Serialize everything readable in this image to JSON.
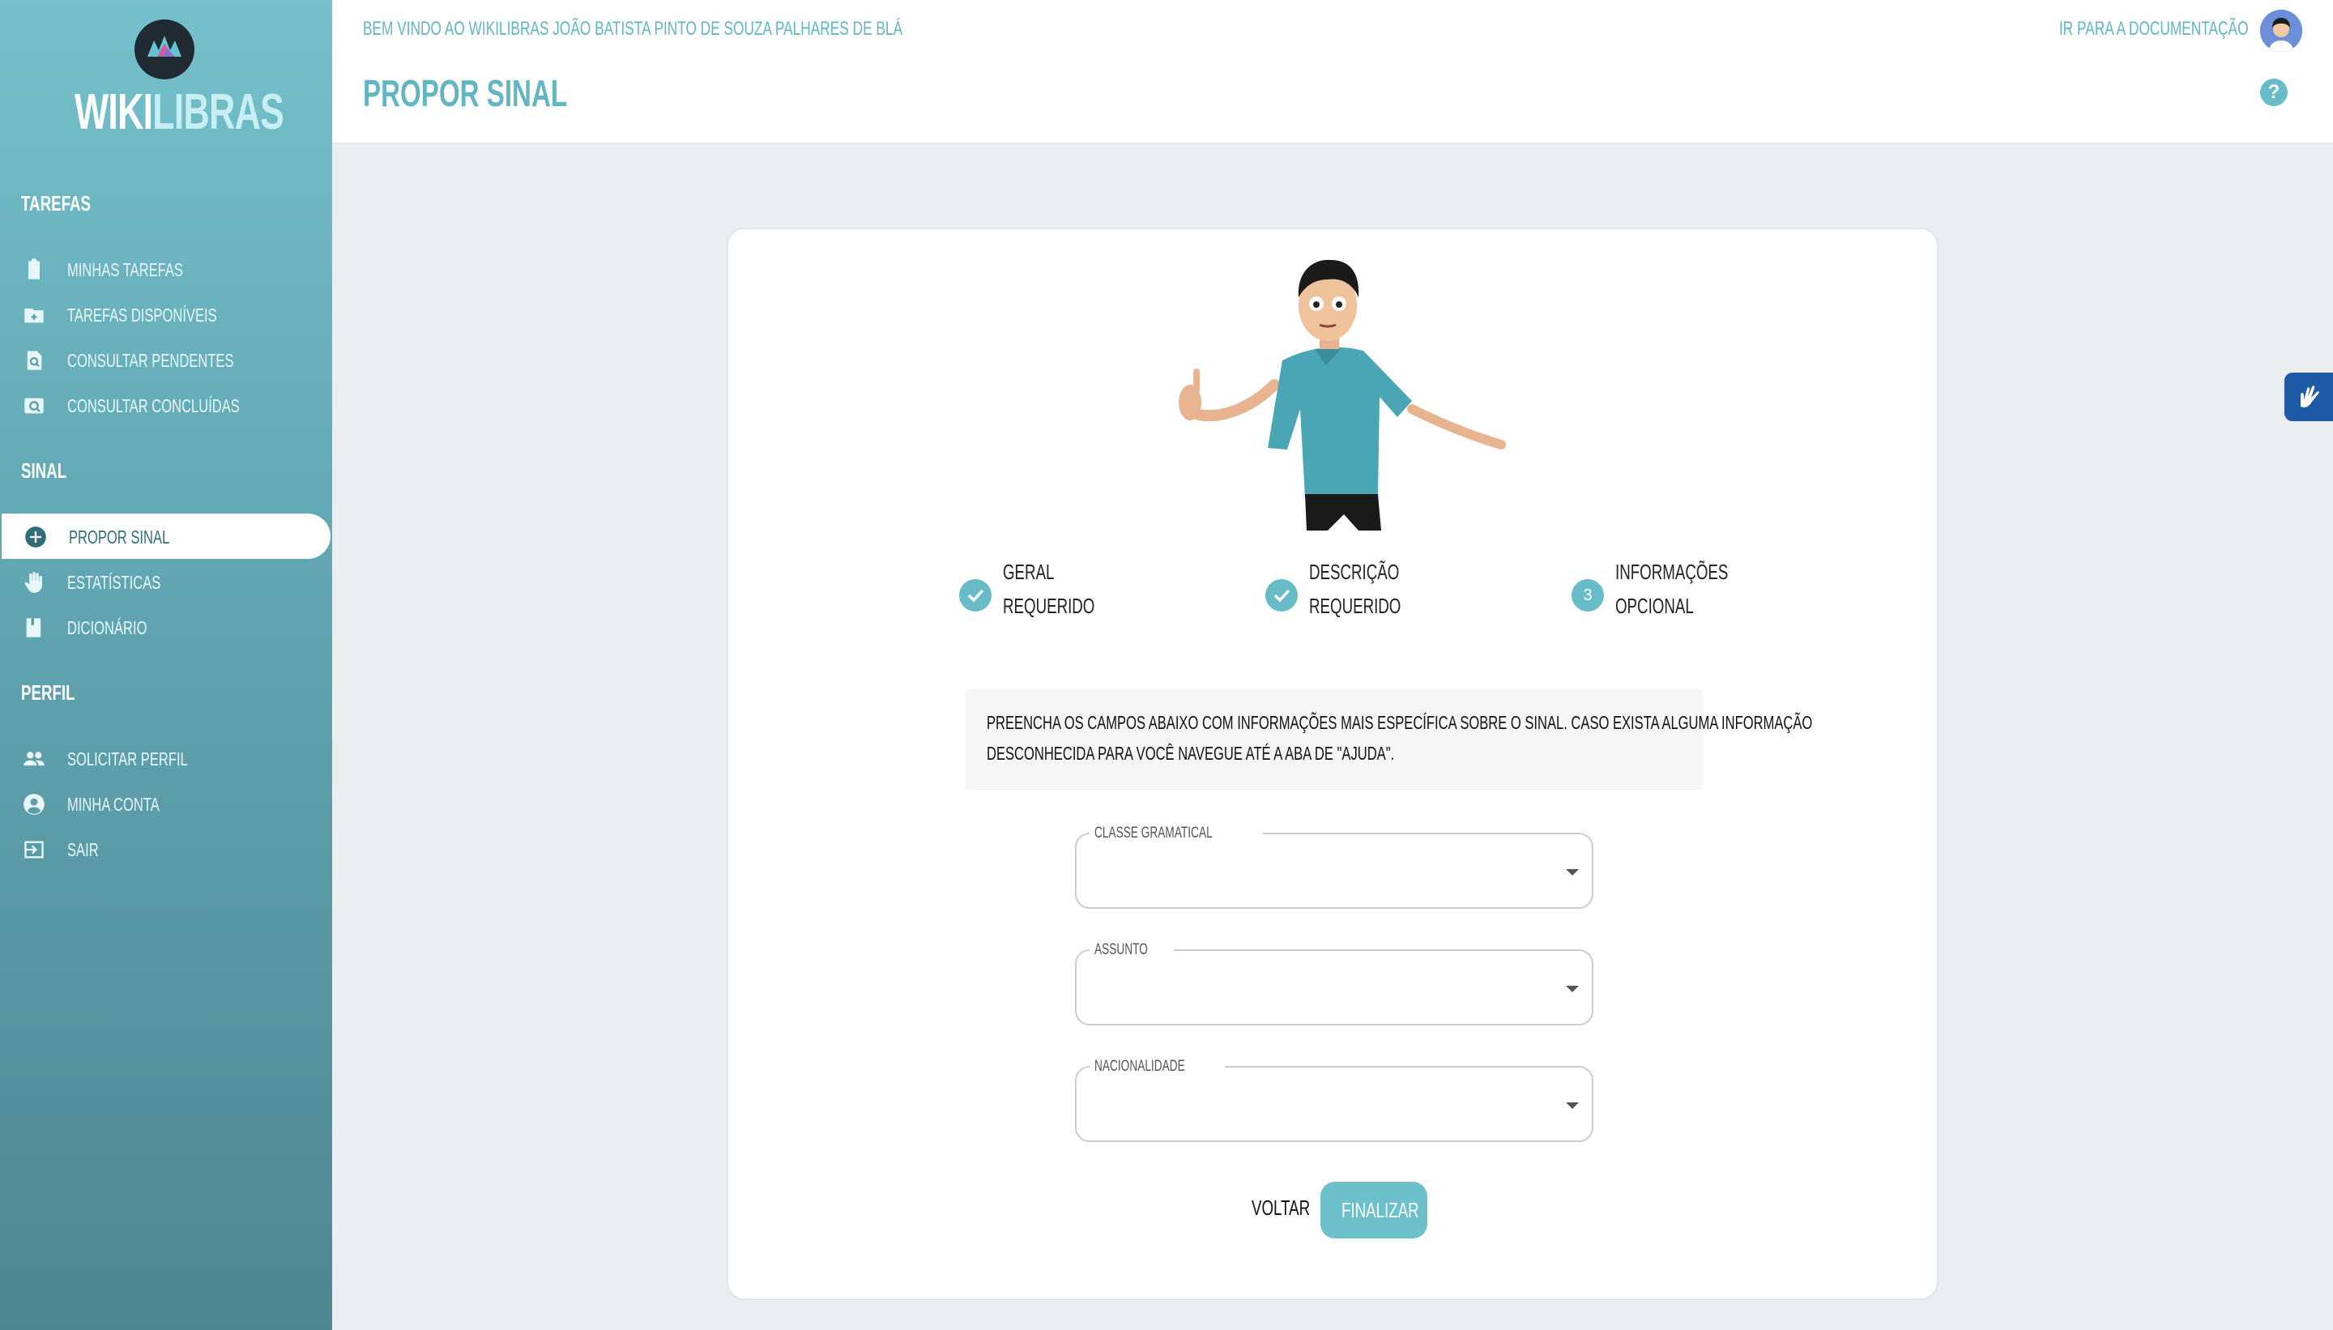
{
  "app": {
    "logo_main": "WIKI",
    "logo_accent": "LIBRAS"
  },
  "sidebar": {
    "sections": [
      {
        "title": "TAREFAS",
        "items": [
          {
            "label": "MINHAS TAREFAS",
            "icon": "clipboard-icon"
          },
          {
            "label": "TAREFAS DISPONÍVEIS",
            "icon": "folder-plus-icon"
          },
          {
            "label": "CONSULTAR PENDENTES",
            "icon": "search-doc-icon"
          },
          {
            "label": "CONSULTAR CONCLUÍDAS",
            "icon": "search-photo-icon"
          }
        ]
      },
      {
        "title": "SINAL",
        "items": [
          {
            "label": "PROPOR SINAL",
            "icon": "plus-circle-icon",
            "active": true
          },
          {
            "label": "ESTATÍSTICAS",
            "icon": "hand-icon"
          },
          {
            "label": "DICIONÁRIO",
            "icon": "book-icon"
          }
        ]
      },
      {
        "title": "PERFIL",
        "items": [
          {
            "label": "SOLICITAR PERFIL",
            "icon": "people-icon"
          },
          {
            "label": "MINHA CONTA",
            "icon": "account-circle-icon"
          },
          {
            "label": "SAIR",
            "icon": "logout-icon"
          }
        ]
      }
    ]
  },
  "header": {
    "welcome": "BEM VINDO AO WIKILIBRAS JOÃO BATISTA PINTO DE SOUZA PALHARES DE BLÁ",
    "title": "PROPOR SINAL",
    "doc_link": "IR PARA A DOCUMENTAÇÃO",
    "help": "?"
  },
  "stepper": [
    {
      "name": "GERAL",
      "sub": "REQUERIDO",
      "state": "done"
    },
    {
      "name": "DESCRIÇÃO",
      "sub": "REQUERIDO",
      "state": "done"
    },
    {
      "name": "INFORMAÇÕES",
      "sub": "OPCIONAL",
      "state": "current",
      "number": "3"
    }
  ],
  "info": {
    "line1": "PREENCHA OS CAMPOS ABAIXO COM INFORMAÇÕES MAIS ESPECÍFICA SOBRE O SINAL. CASO EXISTA ALGUMA INFORMAÇÃO",
    "line2": "DESCONHECIDA PARA VOCÊ NAVEGUE ATÉ A ABA DE \"AJUDA\"."
  },
  "form": {
    "fields": [
      {
        "label": "CLASSE GRAMATICAL",
        "value": ""
      },
      {
        "label": "ASSUNTO",
        "value": ""
      },
      {
        "label": "NACIONALIDADE",
        "value": ""
      }
    ],
    "back_label": "VOLTAR",
    "finish_label": "FINALIZAR"
  },
  "colors": {
    "accent": "#68bcc8",
    "sidebar_top": "#74c0cb",
    "sidebar_bottom": "#4f8791",
    "widget": "#1f5aa6"
  }
}
